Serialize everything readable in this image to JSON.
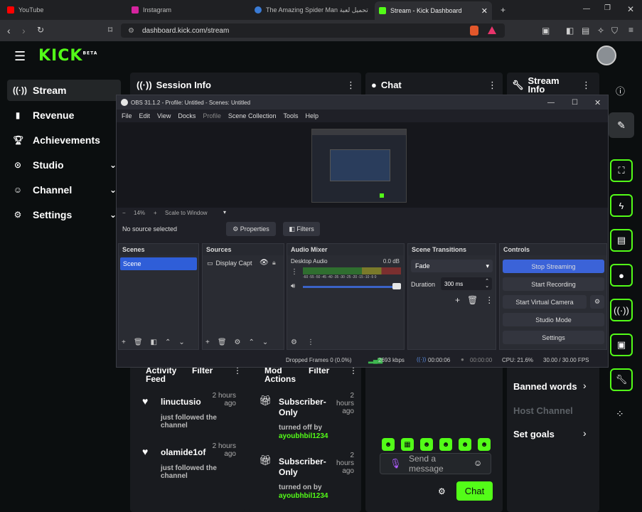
{
  "browser": {
    "tabs": [
      {
        "label": "YouTube"
      },
      {
        "label": "Instagram"
      },
      {
        "label": "The Amazing Spider Man تحميل لعبة"
      },
      {
        "label": "Stream - Kick Dashboard"
      }
    ],
    "url": "dashboard.kick.com/stream"
  },
  "kick": {
    "logo": "KICK",
    "logo_badge": "BETA",
    "sidebar": [
      {
        "label": "Stream"
      },
      {
        "label": "Revenue"
      },
      {
        "label": "Achievements"
      },
      {
        "label": "Studio"
      },
      {
        "label": "Channel"
      },
      {
        "label": "Settings"
      }
    ],
    "session_info": "Session Info",
    "chat": "Chat",
    "stream_info": "Stream Info",
    "activity_feed": "Activity Feed",
    "filter": "Filter",
    "mod_actions": "Mod Actions",
    "feed": [
      {
        "user": "linuctusio",
        "time": "2 hours ago",
        "text": "just followed the channel"
      },
      {
        "user": "olamide1of",
        "time": "2 hours ago",
        "text": "just followed the channel"
      }
    ],
    "mod": [
      {
        "title": "Subscriber-Only",
        "time": "2 hours ago",
        "text": "turned off by",
        "user": "ayoubhbil1234"
      },
      {
        "title": "Subscriber-Only",
        "time": "2 hours ago",
        "text": "turned on by",
        "user": "ayoubhbil1234"
      }
    ],
    "chat_placeholder": "Send a message",
    "chat_button": "Chat",
    "banned_words": "Banned words",
    "host_channel": "Host Channel",
    "set_goals": "Set goals"
  },
  "obs": {
    "title": "OBS 31.1.2 - Profile: Untitled - Scenes: Untitled",
    "menu": [
      "File",
      "Edit",
      "View",
      "Docks",
      "Profile",
      "Scene Collection",
      "Tools",
      "Help"
    ],
    "zoom": "14%",
    "scale": "Scale to Window",
    "no_source": "No source selected",
    "properties": "Properties",
    "filters": "Filters",
    "docks": {
      "scenes": "Scenes",
      "sources": "Sources",
      "audio": "Audio Mixer",
      "transitions": "Scene Transitions",
      "controls": "Controls"
    },
    "scene_item": "Scene",
    "source_item": "Display Capt",
    "audio_device": "Desktop Audio",
    "audio_db": "0.0 dB",
    "meter_ticks": "-60 -55 -50 -45 -40 -35 -30 -25 -20 -15 -10 -5 0",
    "transition": "Fade",
    "duration_label": "Duration",
    "duration_value": "300 ms",
    "controls": [
      "Stop Streaming",
      "Start Recording",
      "Start Virtual Camera",
      "Studio Mode",
      "Settings"
    ],
    "status": {
      "dropped": "Dropped Frames 0 (0.0%)",
      "kbps": "2693 kbps",
      "stream_time": "00:00:06",
      "rec_time": "00:00:00",
      "cpu": "CPU: 21.6%",
      "fps": "30.00 / 30.00 FPS"
    }
  }
}
